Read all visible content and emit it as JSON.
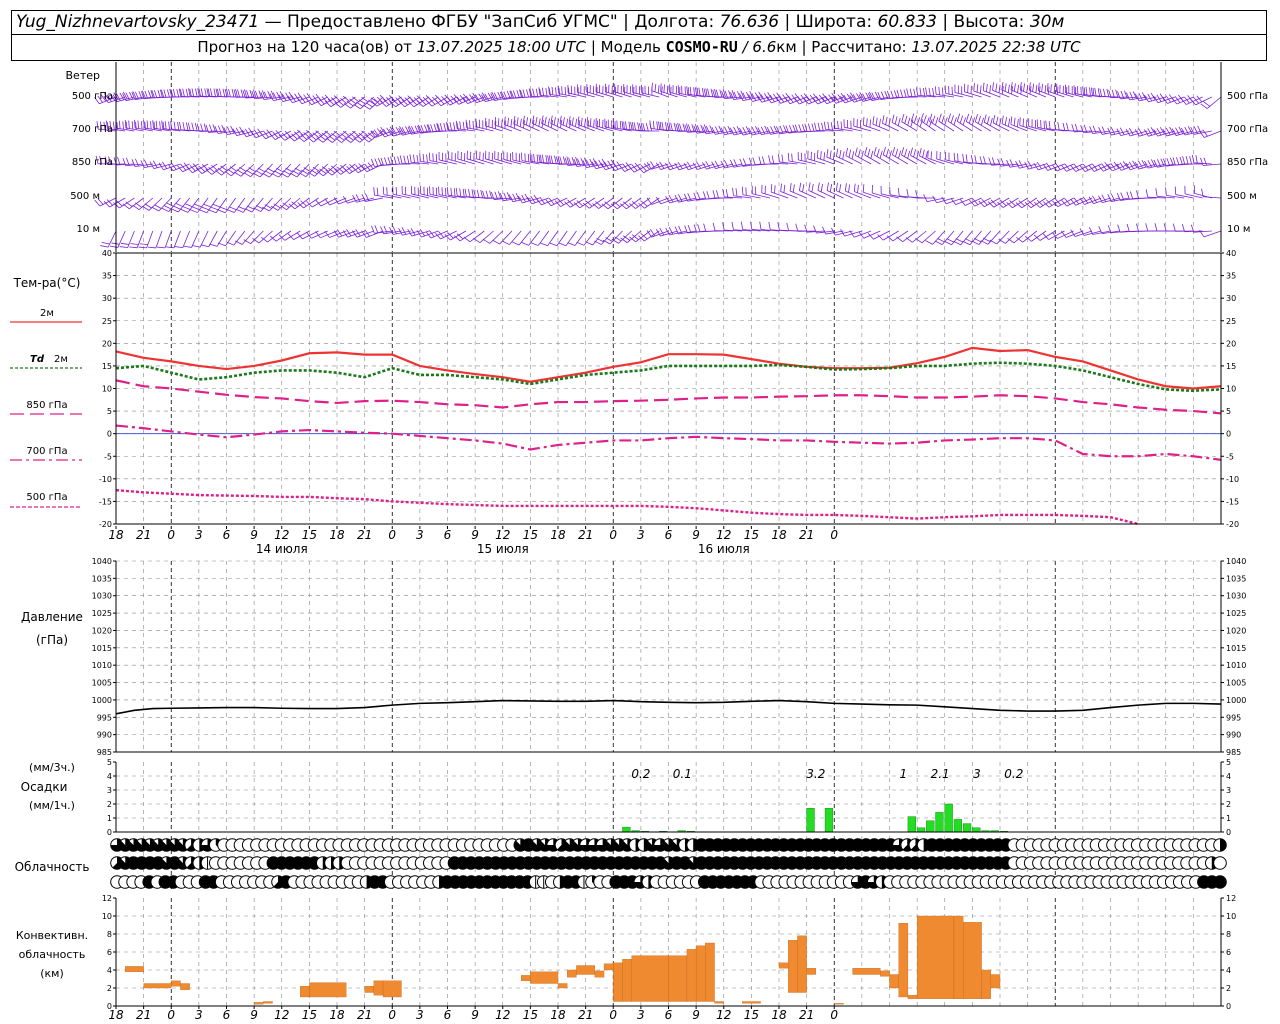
{
  "header": {
    "station": "Yug_Nizhnevartovsky_23471",
    "provider": "— Предоставлено ФГБУ \"ЗапСиб УГМС\"",
    "lon_label": "Долгота:",
    "lon": "76.636",
    "lat_label": "Широта:",
    "lat": "60.833",
    "alt_label": "Высота:",
    "alt": "30м",
    "forecast_label": "Прогноз на 120 часа(ов) от",
    "forecast_time": "13.07.2025 18:00 UTC",
    "model_label": "Модель",
    "model_name": "COSMO-RU",
    "model_res": "/ 6.6",
    "model_res_unit": "км",
    "calc_label": "Рассчитано:",
    "calc_time": "13.07.2025 22:38 UTC"
  },
  "labels": {
    "wind": "Ветер",
    "wind_levels": [
      "500 гПа",
      "700 гПа",
      "850 гПа",
      "500 м",
      "10  м"
    ],
    "wind_levels_right": [
      "500 гПа",
      "700 гПа",
      "850 гПа",
      "500 м",
      "10  м"
    ],
    "temp": "Тем-ра(°C)",
    "t2m": "2м",
    "td_prefix": "Td",
    "td_suffix": "2м",
    "t850": "850 гПа",
    "t700": "700 гПа",
    "t500": "500 гПа",
    "pressure": "Давление",
    "pressure_unit": "(гПа)",
    "precip_unit3": "(мм/3ч.)",
    "precip": "Осадки",
    "precip_unit1": "(мм/1ч.)",
    "cloud": "Облачность",
    "conv1": "Конвективн.",
    "conv2": "облачность",
    "conv3": "(км)"
  },
  "colors": {
    "t2m": "#ee3333",
    "td2m": "#1a7a1a",
    "temp_upper": "#e0208a",
    "wind": "#7a1fd6",
    "precip": "#22dd22",
    "conv": "#f08a30",
    "pressure": "#000000",
    "zero_line": "#3344cc"
  },
  "chart_data": [
    {
      "type": "wind_barbs",
      "levels": [
        "500 гПа",
        "700 гПа",
        "850 гПа",
        "500 м",
        "10  м"
      ],
      "x_hours": [
        0,
        120
      ],
      "interval_hours": 1,
      "unit": "m/s"
    },
    {
      "type": "line",
      "ylim": [
        -20,
        40
      ],
      "yticks": [
        -20,
        -15,
        -10,
        -5,
        0,
        5,
        10,
        15,
        20,
        25,
        30,
        35,
        40
      ],
      "x_ticks": [
        "18",
        "21",
        "0",
        "3",
        "6",
        "9",
        "12",
        "15",
        "18",
        "21",
        "0",
        "3",
        "6",
        "9",
        "12",
        "15",
        "18",
        "21",
        "0",
        "3",
        "6",
        "9",
        "12",
        "15",
        "18",
        "21",
        "0"
      ],
      "date_labels": [
        "14 июля",
        "15 июля",
        "16 июля"
      ],
      "series": [
        {
          "name": "2м",
          "x": [
            0,
            3,
            6,
            9,
            12,
            15,
            18,
            21,
            24,
            27,
            30,
            33,
            36,
            39,
            42,
            45,
            48,
            51,
            54,
            57,
            60,
            63,
            66,
            69,
            72,
            75,
            78,
            81,
            84,
            87,
            90,
            93,
            96,
            99,
            102,
            105,
            108,
            111,
            114,
            117,
            120
          ],
          "y": [
            18.2,
            16.8,
            16.0,
            15.0,
            14.3,
            15.0,
            16.2,
            17.8,
            18.0,
            17.5,
            17.5,
            15.0,
            14.0,
            13.2,
            12.5,
            11.5,
            12.5,
            13.5,
            14.8,
            15.8,
            17.6,
            17.6,
            17.5,
            16.5,
            15.5,
            14.8,
            14.5,
            14.5,
            14.6,
            15.6,
            17.0,
            19.0,
            18.3,
            18.5,
            17.0,
            16.0,
            14.0,
            12.0,
            10.5,
            10.0,
            10.5
          ]
        },
        {
          "name": "Td 2м",
          "x": [
            0,
            3,
            6,
            9,
            12,
            15,
            18,
            21,
            24,
            27,
            30,
            33,
            36,
            39,
            42,
            45,
            48,
            51,
            54,
            57,
            60,
            63,
            66,
            69,
            72,
            75,
            78,
            81,
            84,
            87,
            90,
            93,
            96,
            99,
            102,
            105,
            108,
            111,
            114,
            117,
            120
          ],
          "y": [
            14.5,
            15.0,
            13.5,
            12.0,
            12.5,
            13.5,
            14.0,
            14.0,
            13.5,
            12.5,
            14.5,
            13.0,
            13.0,
            12.5,
            12.0,
            11.0,
            12.0,
            13.0,
            13.5,
            14.0,
            15.0,
            15.0,
            15.0,
            15.0,
            15.2,
            14.8,
            14.2,
            14.3,
            14.5,
            15.0,
            15.0,
            15.5,
            15.7,
            15.5,
            15.0,
            14.0,
            12.5,
            11.0,
            9.8,
            9.5,
            9.8
          ]
        },
        {
          "name": "850 гПа",
          "x": [
            0,
            3,
            6,
            9,
            12,
            15,
            18,
            21,
            24,
            27,
            30,
            33,
            36,
            39,
            42,
            45,
            48,
            51,
            54,
            57,
            60,
            63,
            66,
            69,
            72,
            75,
            78,
            81,
            84,
            87,
            90,
            93,
            96,
            99,
            102,
            105,
            108,
            111,
            114,
            117,
            120
          ],
          "y": [
            11.8,
            10.5,
            10.0,
            9.3,
            8.6,
            8.1,
            7.8,
            7.2,
            6.8,
            7.2,
            7.3,
            7.0,
            6.5,
            6.3,
            5.8,
            6.5,
            7.0,
            7.0,
            7.2,
            7.3,
            7.5,
            7.8,
            8.0,
            8.0,
            8.2,
            8.3,
            8.5,
            8.5,
            8.3,
            8.0,
            8.0,
            8.2,
            8.5,
            8.3,
            7.8,
            7.0,
            6.5,
            5.8,
            5.3,
            5.0,
            4.5
          ]
        },
        {
          "name": "700 гПа",
          "x": [
            0,
            3,
            6,
            9,
            12,
            15,
            18,
            21,
            24,
            27,
            30,
            33,
            36,
            39,
            42,
            45,
            48,
            51,
            54,
            57,
            60,
            63,
            66,
            69,
            72,
            75,
            78,
            81,
            84,
            87,
            90,
            93,
            96,
            99,
            102,
            105,
            108,
            111,
            114,
            117,
            120
          ],
          "y": [
            1.8,
            1.2,
            0.5,
            -0.2,
            -0.8,
            -0.2,
            0.5,
            0.8,
            0.5,
            0.2,
            0.0,
            -0.5,
            -1.0,
            -1.5,
            -2.2,
            -3.5,
            -2.5,
            -2.0,
            -1.5,
            -1.5,
            -1.0,
            -0.7,
            -1.0,
            -1.2,
            -1.5,
            -1.5,
            -1.8,
            -2.0,
            -2.2,
            -2.0,
            -1.5,
            -1.3,
            -1.0,
            -1.0,
            -1.5,
            -4.5,
            -5.0,
            -5.0,
            -4.5,
            -5.0,
            -5.8
          ]
        },
        {
          "name": "500 гПа",
          "x": [
            0,
            3,
            6,
            9,
            12,
            15,
            18,
            21,
            24,
            27,
            30,
            33,
            36,
            39,
            42,
            45,
            48,
            51,
            54,
            57,
            60,
            63,
            66,
            69,
            72,
            75,
            78,
            81,
            84,
            87,
            90,
            93,
            96,
            99,
            102,
            105,
            108,
            111
          ],
          "y": [
            -12.5,
            -13.0,
            -13.3,
            -13.6,
            -13.7,
            -13.8,
            -14.0,
            -14.0,
            -14.3,
            -14.5,
            -15.0,
            -15.3,
            -15.6,
            -15.8,
            -16.0,
            -16.0,
            -16.0,
            -16.0,
            -16.0,
            -16.0,
            -16.2,
            -16.5,
            -17.0,
            -17.5,
            -17.8,
            -18.0,
            -18.0,
            -18.2,
            -18.5,
            -18.8,
            -18.5,
            -18.3,
            -18.0,
            -18.0,
            -18.0,
            -18.2,
            -18.5,
            -20.0
          ]
        }
      ]
    },
    {
      "type": "line",
      "ylim": [
        985,
        1040
      ],
      "yticks": [
        985,
        990,
        995,
        1000,
        1005,
        1010,
        1015,
        1020,
        1025,
        1030,
        1035,
        1040
      ],
      "series": [
        {
          "name": "Давление",
          "x": [
            0,
            2,
            4,
            6,
            9,
            12,
            15,
            18,
            21,
            24,
            27,
            30,
            33,
            36,
            39,
            42,
            45,
            48,
            51,
            54,
            57,
            60,
            63,
            66,
            69,
            72,
            75,
            78,
            81,
            84,
            87,
            90,
            93,
            96,
            99,
            102,
            105,
            108,
            111,
            114,
            117,
            120
          ],
          "y": [
            996.0,
            997.0,
            997.5,
            997.6,
            997.7,
            997.8,
            997.8,
            997.6,
            997.5,
            997.5,
            997.8,
            998.5,
            999.0,
            999.2,
            999.5,
            999.8,
            999.7,
            999.6,
            999.6,
            999.8,
            999.5,
            999.3,
            999.2,
            999.3,
            999.6,
            999.8,
            999.5,
            999.0,
            998.8,
            998.6,
            998.5,
            998.0,
            997.5,
            997.0,
            996.8,
            996.8,
            997.0,
            997.8,
            998.5,
            999.0,
            999.0,
            998.8
          ]
        }
      ]
    },
    {
      "type": "bar",
      "ylim": [
        0,
        5
      ],
      "yticks": [
        0,
        1,
        2,
        3,
        4,
        5
      ],
      "bar_width_hours": 1,
      "hours": [
        55,
        56,
        57,
        59,
        61,
        62,
        75,
        77,
        86,
        87,
        88,
        89,
        90,
        91,
        92,
        93,
        94,
        95,
        96
      ],
      "values": [
        0.35,
        0.1,
        0.05,
        0.05,
        0.1,
        0.05,
        1.7,
        1.7,
        1.1,
        0.3,
        0.8,
        1.4,
        2.0,
        0.9,
        0.6,
        0.3,
        0.1,
        0.1,
        0.05
      ],
      "totals_3h": [
        {
          "hour": 57,
          "text": "0.2"
        },
        {
          "hour": 61.5,
          "text": "0.1"
        },
        {
          "hour": 76,
          "text": "3.2"
        },
        {
          "hour": 85.5,
          "text": "1"
        },
        {
          "hour": 89.5,
          "text": "2.1"
        },
        {
          "hour": 93.5,
          "text": "3"
        },
        {
          "hour": 97.5,
          "text": "0.2"
        }
      ]
    },
    {
      "type": "table",
      "name": "cloud_cover",
      "rows": 3,
      "step_hours": 1,
      "encoding": "eighths 0-8",
      "row_values": [
        "677777777546300000000000000000000000000000000000078776577666777447677448888888888888888888888886554888888888800000000000000000000000004",
        "578888787542000000088888844400000000000008888888888888888888888888878878888888888888888888888888888888888888800000000000000000000000040",
        "000080880008800000005800000000048800000048888888888811048813008886400000088888880000000000006864000000000000000000000000000000000000000888"
      ]
    },
    {
      "type": "bar",
      "name": "convective_cloud",
      "ylim": [
        0,
        12
      ],
      "yticks": [
        0,
        2,
        4,
        6,
        8,
        10,
        12
      ],
      "segments": [
        {
          "x0": 1,
          "x1": 3,
          "y0": 3.8,
          "y1": 4.4
        },
        {
          "x0": 3,
          "x1": 6,
          "y0": 2.0,
          "y1": 2.5
        },
        {
          "x0": 6,
          "x1": 7,
          "y0": 2.2,
          "y1": 2.8
        },
        {
          "x0": 7,
          "x1": 8,
          "y0": 1.8,
          "y1": 2.5
        },
        {
          "x0": 15,
          "x1": 16,
          "y0": 0.2,
          "y1": 0.4
        },
        {
          "x0": 16,
          "x1": 17,
          "y0": 0.3,
          "y1": 0.5
        },
        {
          "x0": 20,
          "x1": 21,
          "y0": 1.0,
          "y1": 2.2
        },
        {
          "x0": 21,
          "x1": 25,
          "y0": 1.0,
          "y1": 2.6
        },
        {
          "x0": 27,
          "x1": 28,
          "y0": 1.5,
          "y1": 2.2
        },
        {
          "x0": 28,
          "x1": 29,
          "y0": 1.2,
          "y1": 2.8
        },
        {
          "x0": 29,
          "x1": 31,
          "y0": 1.0,
          "y1": 2.8
        },
        {
          "x0": 44,
          "x1": 45,
          "y0": 2.8,
          "y1": 3.4
        },
        {
          "x0": 45,
          "x1": 48,
          "y0": 2.5,
          "y1": 3.8
        },
        {
          "x0": 48,
          "x1": 49,
          "y0": 2.0,
          "y1": 2.5
        },
        {
          "x0": 49,
          "x1": 50,
          "y0": 3.2,
          "y1": 4.0
        },
        {
          "x0": 50,
          "x1": 52,
          "y0": 3.5,
          "y1": 4.5
        },
        {
          "x0": 52,
          "x1": 53,
          "y0": 3.2,
          "y1": 3.9
        },
        {
          "x0": 53,
          "x1": 54,
          "y0": 4.0,
          "y1": 4.7
        },
        {
          "x0": 54,
          "x1": 55,
          "y0": 0.5,
          "y1": 4.8
        },
        {
          "x0": 55,
          "x1": 56,
          "y0": 0.5,
          "y1": 5.2
        },
        {
          "x0": 56,
          "x1": 60,
          "y0": 0.5,
          "y1": 5.6
        },
        {
          "x0": 60,
          "x1": 62,
          "y0": 0.5,
          "y1": 5.6
        },
        {
          "x0": 62,
          "x1": 63,
          "y0": 0.5,
          "y1": 6.3
        },
        {
          "x0": 63,
          "x1": 64,
          "y0": 0.5,
          "y1": 6.7
        },
        {
          "x0": 64,
          "x1": 65,
          "y0": 0.5,
          "y1": 7.0
        },
        {
          "x0": 65,
          "x1": 66,
          "y0": 0.3,
          "y1": 0.5
        },
        {
          "x0": 68,
          "x1": 70,
          "y0": 0.3,
          "y1": 0.5
        },
        {
          "x0": 72,
          "x1": 73,
          "y0": 4.2,
          "y1": 4.8
        },
        {
          "x0": 73,
          "x1": 74,
          "y0": 1.5,
          "y1": 7.3
        },
        {
          "x0": 74,
          "x1": 75,
          "y0": 1.5,
          "y1": 7.8
        },
        {
          "x0": 75,
          "x1": 76,
          "y0": 3.5,
          "y1": 4.2
        },
        {
          "x0": 78,
          "x1": 79,
          "y0": 0.2,
          "y1": 0.3
        },
        {
          "x0": 80,
          "x1": 83,
          "y0": 3.5,
          "y1": 4.2
        },
        {
          "x0": 83,
          "x1": 84,
          "y0": 3.3,
          "y1": 3.9
        },
        {
          "x0": 84,
          "x1": 85,
          "y0": 2.0,
          "y1": 3.5
        },
        {
          "x0": 85,
          "x1": 86,
          "y0": 1.0,
          "y1": 9.2
        },
        {
          "x0": 86,
          "x1": 87,
          "y0": 0.8,
          "y1": 1.2
        },
        {
          "x0": 87,
          "x1": 91,
          "y0": 0.8,
          "y1": 10.0
        },
        {
          "x0": 91,
          "x1": 92,
          "y0": 0.8,
          "y1": 10.0
        },
        {
          "x0": 92,
          "x1": 94,
          "y0": 0.8,
          "y1": 9.3
        },
        {
          "x0": 94,
          "x1": 95,
          "y0": 0.8,
          "y1": 4.0
        },
        {
          "x0": 95,
          "x1": 96,
          "y0": 2.0,
          "y1": 3.5
        }
      ]
    }
  ]
}
